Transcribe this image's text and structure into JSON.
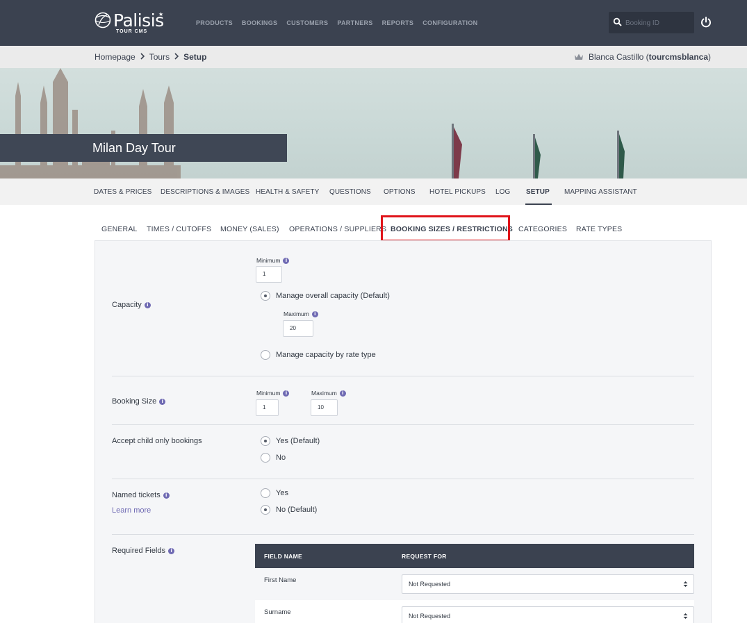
{
  "app": {
    "logo_text": "Palisis",
    "logo_sub": "TOUR CMS",
    "nav": [
      "PRODUCTS",
      "BOOKINGS",
      "CUSTOMERS",
      "PARTNERS",
      "REPORTS",
      "CONFIGURATION"
    ],
    "search_placeholder": "Booking ID"
  },
  "breadcrumb": {
    "items": [
      "Homepage",
      "Tours"
    ],
    "current": "Setup"
  },
  "user": {
    "name": "Blanca Castillo (",
    "username": "tourcmsblanca",
    "close": ")"
  },
  "hero": {
    "title": "Milan Day Tour"
  },
  "main_tabs": [
    "DATES & PRICES",
    "DESCRIPTIONS & IMAGES",
    "HEALTH & SAFETY",
    "QUESTIONS",
    "OPTIONS",
    "HOTEL PICKUPS",
    "LOG",
    "SETUP",
    "MAPPING ASSISTANT"
  ],
  "main_tab_active": "SETUP",
  "sub_tabs": [
    "GENERAL",
    "TIMES / CUTOFFS",
    "MONEY (SALES)",
    "OPERATIONS / SUPPLIERS",
    "BOOKING SIZES / RESTRICTIONS",
    "CATEGORIES",
    "RATE TYPES"
  ],
  "sub_tab_active": "BOOKING SIZES / RESTRICTIONS",
  "capacity": {
    "label": "Capacity",
    "minimum_label": "Minimum",
    "minimum_value": "1",
    "option_overall": "Manage overall capacity (Default)",
    "maximum_label": "Maximum",
    "maximum_value": "20",
    "option_rate": "Manage capacity by rate type",
    "selected": "overall"
  },
  "booking_size": {
    "label": "Booking Size",
    "minimum_label": "Minimum",
    "minimum_value": "1",
    "maximum_label": "Maximum",
    "maximum_value": "10"
  },
  "child_only": {
    "label": "Accept child only bookings",
    "yes": "Yes (Default)",
    "no": "No",
    "selected": "yes"
  },
  "named_tickets": {
    "label": "Named tickets",
    "learn_more": "Learn more",
    "yes": "Yes",
    "no": "No (Default)",
    "selected": "no"
  },
  "required_fields": {
    "label": "Required Fields",
    "col_field": "FIELD NAME",
    "col_request": "REQUEST FOR",
    "rows": [
      {
        "field": "First Name",
        "request": "Not Requested"
      },
      {
        "field": "Surname",
        "request": "Not Requested"
      }
    ]
  },
  "colors": {
    "topbar": "#3b4250",
    "accent": "#6f6ab3",
    "highlight": "#e0141a"
  }
}
